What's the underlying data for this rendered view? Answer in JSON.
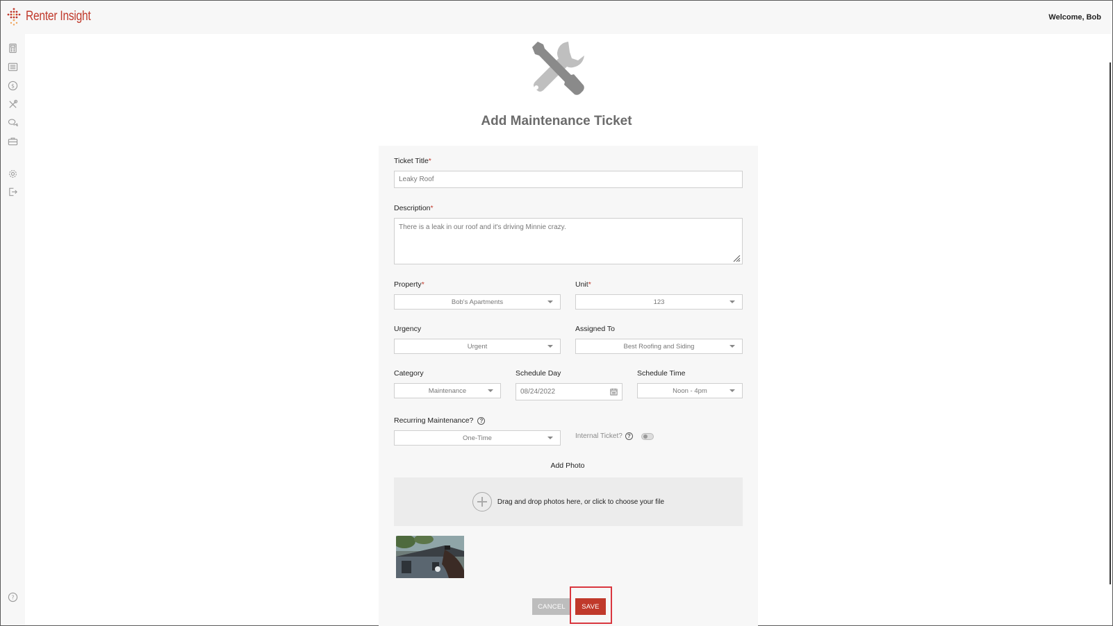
{
  "app": {
    "brand": "Renter Insight",
    "welcome": "Welcome, Bob",
    "accent": "#c0392b"
  },
  "sidebar": {
    "items": [
      {
        "name": "calculator-icon"
      },
      {
        "name": "list-icon"
      },
      {
        "name": "dollar-icon"
      },
      {
        "name": "tools-icon"
      },
      {
        "name": "chat-icon"
      },
      {
        "name": "briefcase-icon"
      },
      {
        "name": "gear-icon"
      },
      {
        "name": "logout-icon"
      },
      {
        "name": "help-icon"
      }
    ]
  },
  "page": {
    "title": "Add Maintenance Ticket",
    "hero_icon": "wrench-screwdriver-icon"
  },
  "form": {
    "ticket_title": {
      "label": "Ticket Title",
      "required": "*",
      "value": "Leaky Roof"
    },
    "description": {
      "label": "Description",
      "required": "*",
      "value": "There is a leak in our roof and it's driving Minnie crazy."
    },
    "property": {
      "label": "Property",
      "required": "*",
      "value": "Bob's Apartments"
    },
    "unit": {
      "label": "Unit",
      "required": "*",
      "value": "123"
    },
    "urgency": {
      "label": "Urgency",
      "value": "Urgent"
    },
    "assigned_to": {
      "label": "Assigned To",
      "value": "Best Roofing and Siding"
    },
    "category": {
      "label": "Category",
      "value": "Maintenance"
    },
    "schedule_day": {
      "label": "Schedule Day",
      "value": "08/24/2022"
    },
    "schedule_time": {
      "label": "Schedule Time",
      "value": "Noon - 4pm"
    },
    "recurring": {
      "label": "Recurring Maintenance?",
      "value": "One-Time",
      "help": "?"
    },
    "internal_ticket": {
      "label": "Internal Ticket?",
      "help": "?",
      "enabled": false
    },
    "photo": {
      "label": "Add Photo",
      "dropzone_text": "Drag and drop photos here, or click to choose your file"
    },
    "buttons": {
      "cancel": "CANCEL",
      "save": "SAVE"
    }
  }
}
